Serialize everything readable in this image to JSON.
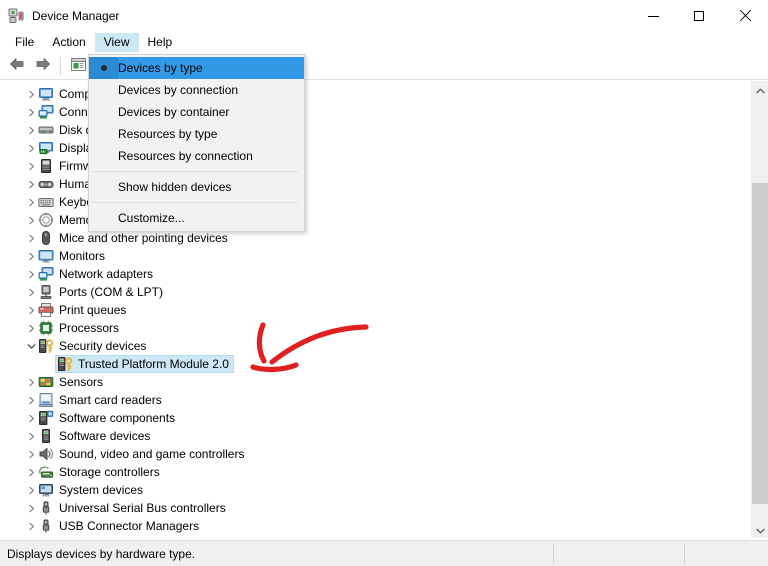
{
  "window": {
    "title": "Device Manager",
    "icon": "device-manager-icon",
    "controls": {
      "minimize": "minimize-icon",
      "maximize": "maximize-icon",
      "close": "close-icon"
    }
  },
  "menubar": {
    "items": [
      {
        "label": "File",
        "active": false
      },
      {
        "label": "Action",
        "active": false
      },
      {
        "label": "View",
        "active": true
      },
      {
        "label": "Help",
        "active": false
      }
    ]
  },
  "toolbar": {
    "buttons": [
      {
        "name": "back-arrow-icon",
        "label": "Back"
      },
      {
        "name": "forward-arrow-icon",
        "label": "Forward"
      },
      {
        "name": "properties-icon",
        "label": "Properties"
      }
    ]
  },
  "view_menu": {
    "open": true,
    "items": [
      {
        "label": "Devices by type",
        "selected": true,
        "radio": true,
        "separator_after": false
      },
      {
        "label": "Devices by connection",
        "selected": false,
        "radio": false,
        "separator_after": false
      },
      {
        "label": "Devices by container",
        "selected": false,
        "radio": false,
        "separator_after": false
      },
      {
        "label": "Resources by type",
        "selected": false,
        "radio": false,
        "separator_after": false
      },
      {
        "label": "Resources by connection",
        "selected": false,
        "radio": false,
        "separator_after": true
      },
      {
        "label": "Show hidden devices",
        "selected": false,
        "radio": false,
        "separator_after": true
      },
      {
        "label": "Customize...",
        "selected": false,
        "radio": false,
        "separator_after": false
      }
    ]
  },
  "tree": {
    "items": [
      {
        "label": "Computer",
        "icon": "computer-icon",
        "expanded": false,
        "indent": 1,
        "selected": false
      },
      {
        "label": "Connected devices",
        "icon": "network-computer-icon",
        "expanded": false,
        "indent": 1,
        "selected": false
      },
      {
        "label": "Disk drives",
        "icon": "disk-drive-icon",
        "expanded": false,
        "indent": 1,
        "selected": false
      },
      {
        "label": "Display adapters",
        "icon": "display-adapter-icon",
        "expanded": false,
        "indent": 1,
        "selected": false
      },
      {
        "label": "Firmware",
        "icon": "firmware-icon",
        "expanded": false,
        "indent": 1,
        "selected": false
      },
      {
        "label": "Human Interface Devices",
        "icon": "hid-icon",
        "expanded": false,
        "indent": 1,
        "selected": false
      },
      {
        "label": "Keyboards",
        "icon": "keyboard-icon",
        "expanded": false,
        "indent": 1,
        "selected": false
      },
      {
        "label": "Memory technology devices",
        "icon": "memory-icon",
        "expanded": false,
        "indent": 1,
        "selected": false
      },
      {
        "label": "Mice and other pointing devices",
        "icon": "mouse-icon",
        "expanded": false,
        "indent": 1,
        "selected": false
      },
      {
        "label": "Monitors",
        "icon": "monitor-icon",
        "expanded": false,
        "indent": 1,
        "selected": false
      },
      {
        "label": "Network adapters",
        "icon": "network-adapter-icon",
        "expanded": false,
        "indent": 1,
        "selected": false
      },
      {
        "label": "Ports (COM & LPT)",
        "icon": "port-icon",
        "expanded": false,
        "indent": 1,
        "selected": false
      },
      {
        "label": "Print queues",
        "icon": "printer-icon",
        "expanded": false,
        "indent": 1,
        "selected": false
      },
      {
        "label": "Processors",
        "icon": "processor-icon",
        "expanded": false,
        "indent": 1,
        "selected": false
      },
      {
        "label": "Security devices",
        "icon": "security-device-icon",
        "expanded": true,
        "indent": 1,
        "selected": false
      },
      {
        "label": "Trusted Platform Module 2.0",
        "icon": "security-device-icon",
        "expanded": null,
        "indent": 2,
        "selected": true
      },
      {
        "label": "Sensors",
        "icon": "sensor-icon",
        "expanded": false,
        "indent": 1,
        "selected": false
      },
      {
        "label": "Smart card readers",
        "icon": "smart-card-reader-icon",
        "expanded": false,
        "indent": 1,
        "selected": false
      },
      {
        "label": "Software components",
        "icon": "software-component-icon",
        "expanded": false,
        "indent": 1,
        "selected": false
      },
      {
        "label": "Software devices",
        "icon": "software-device-icon",
        "expanded": false,
        "indent": 1,
        "selected": false
      },
      {
        "label": "Sound, video and game controllers",
        "icon": "speaker-icon",
        "expanded": false,
        "indent": 1,
        "selected": false
      },
      {
        "label": "Storage controllers",
        "icon": "storage-controller-icon",
        "expanded": false,
        "indent": 1,
        "selected": false
      },
      {
        "label": "System devices",
        "icon": "system-device-icon",
        "expanded": false,
        "indent": 1,
        "selected": false
      },
      {
        "label": "Universal Serial Bus controllers",
        "icon": "usb-icon",
        "expanded": false,
        "indent": 1,
        "selected": false
      },
      {
        "label": "USB Connector Managers",
        "icon": "usb-icon",
        "expanded": false,
        "indent": 1,
        "selected": false
      }
    ]
  },
  "scrollbar": {
    "up_arrow": "chevron-up-icon",
    "down_arrow": "chevron-down-icon",
    "thumb_top_pct": 20,
    "thumb_height_pct": 76
  },
  "statusbar": {
    "text": "Displays devices by hardware type."
  },
  "annotation": {
    "type": "hand-drawn-arrow",
    "color": "#e02020",
    "points_to": "Trusted Platform Module 2.0"
  },
  "colors": {
    "menu_highlight": "#3399e6",
    "menubar_active": "#cce8f5",
    "tree_selection": "#cce8f5",
    "annotation_red": "#e02020"
  }
}
